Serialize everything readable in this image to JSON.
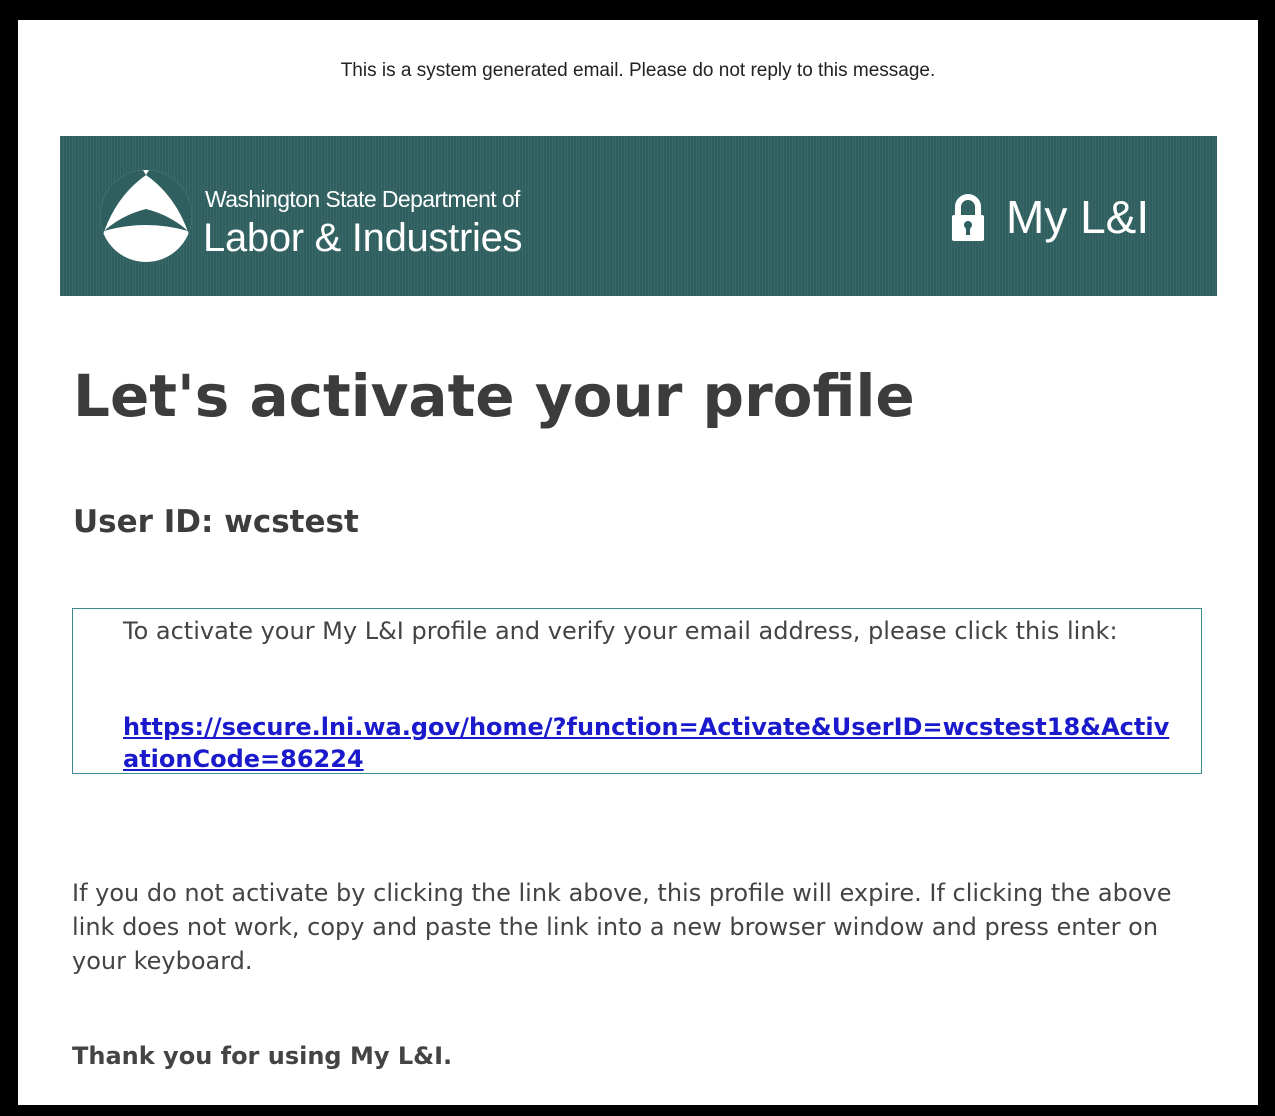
{
  "notice": "This is a system generated email. Please do not reply to this message.",
  "header": {
    "agency_line1": "Washington State Department of",
    "agency_line2": "Labor & Industries",
    "app_name": "My L&I",
    "logo_icon": "wa-lni-logo-icon",
    "lock_icon": "lock-icon",
    "banner_color": "#2f5f5f"
  },
  "main": {
    "title": "Let's activate your profile",
    "user_id": "User ID: wcstest",
    "activation_box": {
      "instructions": "To activate your My L&I profile and verify your email address, please click this link:",
      "link": "https://secure.lni.wa.gov/home/?function=Activate&UserID=wcstest18&ActivationCode=86224",
      "link_color": "#1a1acc"
    },
    "expire_text": "If you do not activate by clicking the link above, this profile will expire. If clicking the above link does not work, copy and paste the link into a new browser window and press enter on your keyboard.",
    "thanks": "Thank you for using My L&I."
  }
}
